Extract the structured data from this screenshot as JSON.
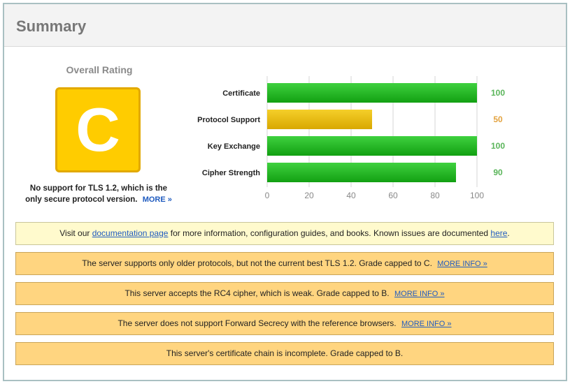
{
  "summary": {
    "title": "Summary"
  },
  "rating": {
    "label": "Overall Rating",
    "grade": "C",
    "note_line1": "No support for TLS 1.2, which is the",
    "note_line2": "only secure protocol version.",
    "more_link": "MORE »"
  },
  "chart_data": {
    "type": "bar",
    "orientation": "horizontal",
    "categories": [
      "Certificate",
      "Protocol Support",
      "Key Exchange",
      "Cipher Strength"
    ],
    "values": [
      100,
      50,
      100,
      90
    ],
    "bar_colors": [
      "#22bb22",
      "#e6b800",
      "#22bb22",
      "#22bb22"
    ],
    "value_colors": [
      "#5ab55a",
      "#e3a340",
      "#5ab55a",
      "#5ab55a"
    ],
    "xlim": [
      0,
      100
    ],
    "xticks": [
      0,
      20,
      40,
      60,
      80,
      100
    ],
    "grid": true
  },
  "notices": [
    {
      "kind": "info",
      "text_before": "Visit our ",
      "link1": "documentation page",
      "text_middle": " for more information, configuration guides, and books. Known issues are documented ",
      "link2": "here",
      "text_after": "."
    },
    {
      "kind": "warning",
      "text": "The server supports only older protocols, but not the current best TLS 1.2. Grade capped to C.",
      "more": "MORE INFO »"
    },
    {
      "kind": "warning",
      "text": "This server accepts the RC4 cipher, which is weak. Grade capped to B.",
      "more": "MORE INFO »"
    },
    {
      "kind": "warning",
      "text": "The server does not support Forward Secrecy with the reference browsers.",
      "more": "MORE INFO »"
    },
    {
      "kind": "warning",
      "text": "This server's certificate chain is incomplete. Grade capped to B."
    }
  ],
  "colors": {
    "grade_fill": "#ffcc00",
    "warning_bg": "#ffd580",
    "info_bg": "#fffacd",
    "link": "#1f5bbf"
  }
}
